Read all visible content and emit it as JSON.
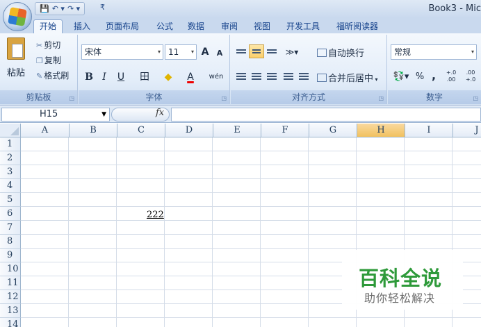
{
  "window": {
    "title": "Book3 - Mic",
    "qat": {
      "save": "💾",
      "undo": "↶ ▾",
      "redo": "↷ ▾",
      "customize": "₹"
    }
  },
  "tabs": [
    "开始",
    "插入",
    "页面布局",
    "公式",
    "数据",
    "审阅",
    "视图",
    "开发工具",
    "福昕阅读器"
  ],
  "active_tab": "开始",
  "ribbon": {
    "clipboard": {
      "paste": "粘贴",
      "cut": "剪切",
      "copy": "复制",
      "format_painter": "格式刷",
      "label": "剪贴板"
    },
    "font": {
      "name": "宋体",
      "size": "11",
      "grow": "A",
      "shrink": "A",
      "bold": "B",
      "italic": "I",
      "underline": "U",
      "border": "田",
      "fill": "◆",
      "font_color": "A",
      "phonetic": "wén",
      "label": "字体"
    },
    "alignment": {
      "wrap_text": "自动换行",
      "merge_center": "合并后居中",
      "label": "对齐方式"
    },
    "number": {
      "format": "常规",
      "percent": "%",
      "comma": ",",
      "inc_decimal": "+.0 .00",
      "dec_decimal": ".00 +.0",
      "label": "数字"
    }
  },
  "formula_bar": {
    "name_box": "H15",
    "fx": "fx",
    "value": ""
  },
  "grid": {
    "columns": [
      "A",
      "B",
      "C",
      "D",
      "E",
      "F",
      "G",
      "H",
      "I",
      "J"
    ],
    "selected_column": "H",
    "rows": [
      "1",
      "2",
      "3",
      "4",
      "5",
      "6",
      "7",
      "8",
      "9",
      "10",
      "11",
      "12",
      "13",
      "14"
    ],
    "cells": {
      "C6": "222"
    }
  },
  "watermark": {
    "title": "百科全说",
    "subtitle": "助你轻松解决"
  },
  "colors": {
    "accent": "#15428b",
    "selected_header": "#f1c15f",
    "watermark_green": "#2e9a3a"
  }
}
